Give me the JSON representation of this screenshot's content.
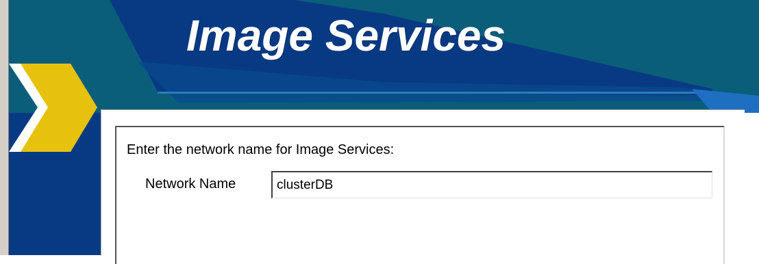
{
  "banner": {
    "title": "Image Services",
    "colors": {
      "primary_navy": "#083a84",
      "teal": "#0b5e7a",
      "arrow_yellow": "#e6c20e"
    }
  },
  "form": {
    "prompt": "Enter the network name for Image Services:",
    "network_name": {
      "label": "Network Name",
      "value": "clusterDB"
    }
  },
  "icons": {
    "arrow": "chevron-right-icon"
  }
}
